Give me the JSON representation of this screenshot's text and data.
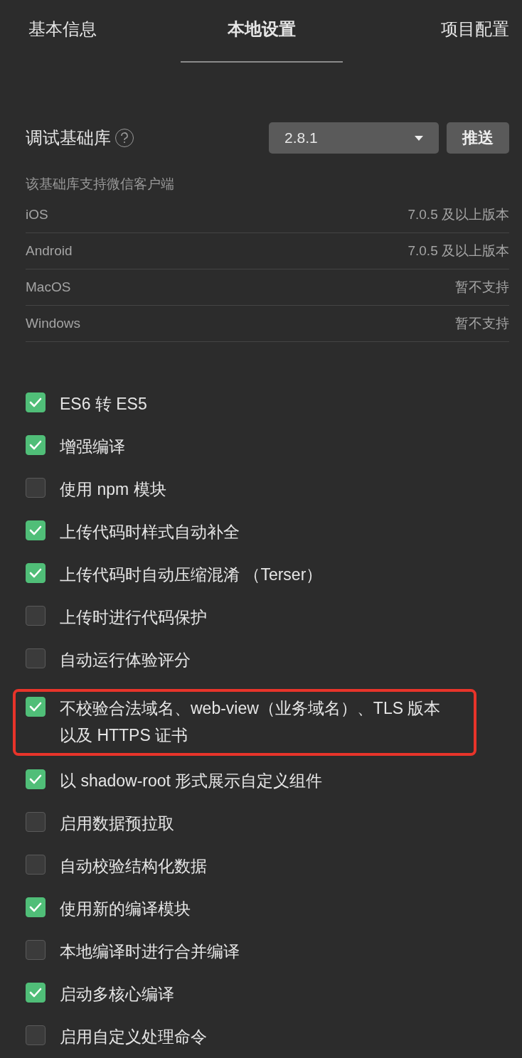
{
  "tabs": [
    {
      "label": "基本信息",
      "selected": false
    },
    {
      "label": "本地设置",
      "selected": true
    },
    {
      "label": "项目配置",
      "selected": false
    }
  ],
  "library": {
    "label": "调试基础库",
    "version": "2.8.1",
    "button": "推送"
  },
  "support": {
    "title": "该基础库支持微信客户端",
    "rows": [
      {
        "platform": "iOS",
        "requirement": "7.0.5 及以上版本"
      },
      {
        "platform": "Android",
        "requirement": "7.0.5 及以上版本"
      },
      {
        "platform": "MacOS",
        "requirement": "暂不支持"
      },
      {
        "platform": "Windows",
        "requirement": "暂不支持"
      }
    ]
  },
  "options": [
    {
      "label": "ES6 转 ES5",
      "checked": true,
      "highlighted": false
    },
    {
      "label": "增强编译",
      "checked": true,
      "highlighted": false
    },
    {
      "label": "使用 npm 模块",
      "checked": false,
      "highlighted": false
    },
    {
      "label": "上传代码时样式自动补全",
      "checked": true,
      "highlighted": false
    },
    {
      "label": "上传代码时自动压缩混淆 （Terser）",
      "checked": true,
      "highlighted": false
    },
    {
      "label": "上传时进行代码保护",
      "checked": false,
      "highlighted": false
    },
    {
      "label": "自动运行体验评分",
      "checked": false,
      "highlighted": false
    },
    {
      "label": "不校验合法域名、web-view（业务域名）、TLS 版本以及 HTTPS 证书",
      "checked": true,
      "highlighted": true
    },
    {
      "label": "以 shadow-root 形式展示自定义组件",
      "checked": true,
      "highlighted": false
    },
    {
      "label": "启用数据预拉取",
      "checked": false,
      "highlighted": false
    },
    {
      "label": "自动校验结构化数据",
      "checked": false,
      "highlighted": false
    },
    {
      "label": "使用新的编译模块",
      "checked": true,
      "highlighted": false
    },
    {
      "label": "本地编译时进行合并编译",
      "checked": false,
      "highlighted": false
    },
    {
      "label": "启动多核心编译",
      "checked": true,
      "highlighted": false
    },
    {
      "label": "启用自定义处理命令",
      "checked": false,
      "highlighted": false
    }
  ]
}
